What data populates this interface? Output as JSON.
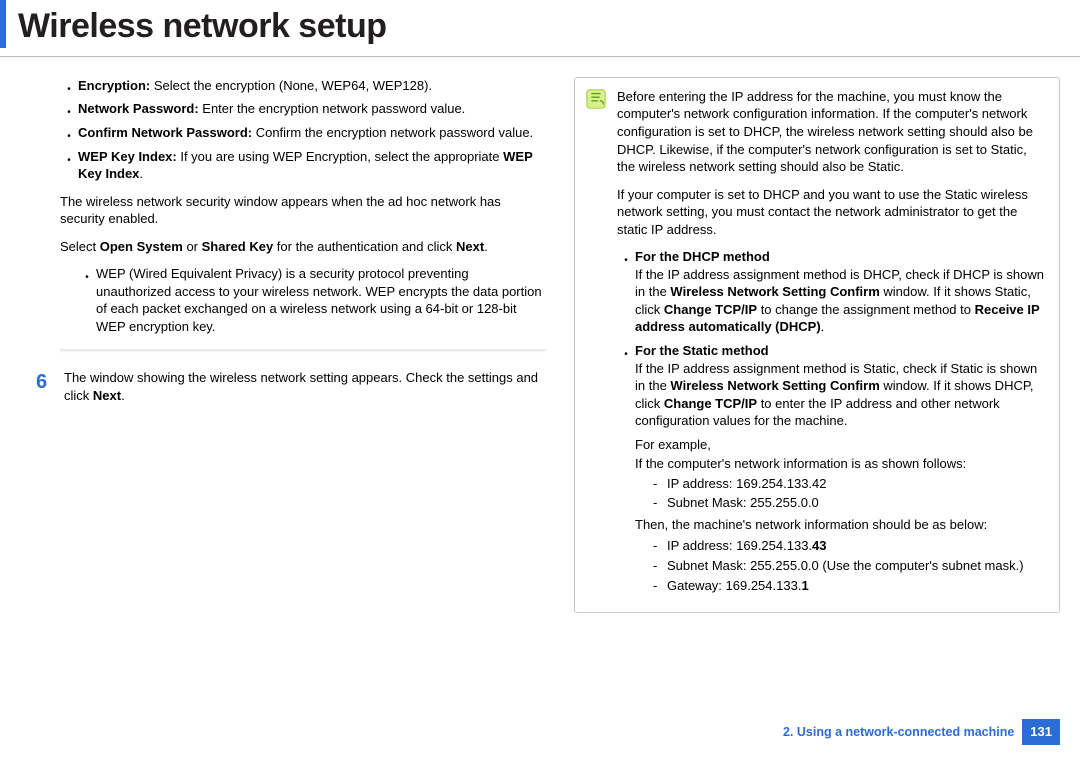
{
  "title": "Wireless network setup",
  "left": {
    "bullets": [
      {
        "label": "Encryption:",
        "text": " Select the encryption (None, WEP64, WEP128)."
      },
      {
        "label": "Network Password:",
        "text": " Enter the encryption network password value."
      },
      {
        "label": "Confirm Network Password:",
        "text": " Confirm the encryption network password value."
      },
      {
        "label": "WEP Key Index:",
        "text": " If you are using WEP Encryption, select the appropriate ",
        "tail_bold": "WEP Key Index",
        "tail_after": "."
      }
    ],
    "para1": "The wireless network security window appears when the ad hoc network has security enabled.",
    "para2_pre": "Select ",
    "para2_b1": "Open System",
    "para2_mid": " or ",
    "para2_b2": "Shared Key",
    "para2_post": " for the authentication and click ",
    "para2_b3": "Next",
    "para2_end": ".",
    "wep_note": "WEP (Wired Equivalent Privacy) is a security protocol preventing unauthorized access to your wireless network. WEP encrypts the data portion of each packet exchanged on a wireless network using a 64-bit or 128-bit WEP encryption key.",
    "step_num": "6",
    "step_text_pre": "The window showing the wireless network setting appears. Check the settings and click ",
    "step_text_b": "Next",
    "step_text_end": "."
  },
  "right": {
    "note1": "Before entering the IP address for the machine, you must know the computer's network configuration information. If the computer's network configuration is set to DHCP, the wireless network setting should also be DHCP. Likewise, if the computer's network configuration is set to Static, the wireless network setting should also be Static.",
    "note2": "If your computer is set to DHCP and you want to use the Static wireless network setting, you must contact the network administrator to get the static IP address.",
    "dhcp_heading": "For the DHCP method",
    "dhcp_pre": "If the IP address assignment method is DHCP, check if DHCP is shown in the ",
    "dhcp_b1": "Wireless Network Setting Confirm",
    "dhcp_mid1": " window. If it shows Static, click ",
    "dhcp_b2": "Change TCP/IP",
    "dhcp_mid2": " to change the assignment method to ",
    "dhcp_b3": "Receive IP address automatically (DHCP)",
    "dhcp_end": ".",
    "static_heading": "For the Static method",
    "static_pre": "If the IP address assignment method is Static, check if Static is shown in the ",
    "static_b1": "Wireless Network Setting Confirm",
    "static_mid1": " window. If it shows DHCP, click ",
    "static_b2": "Change TCP/IP",
    "static_mid2": " to enter the IP address and other network configuration values for the machine.",
    "for_example": "For example,",
    "follows": "If the computer's network information is as shown follows:",
    "ip1_label": "IP address: ",
    "ip1_val": "169.254.133.42",
    "mask1_label": "Subnet Mask: ",
    "mask1_val": "255.255.0.0",
    "then": "Then, the machine's network information should be as below:",
    "ip2_label": "IP address: 169.254.133.",
    "ip2_bold": "43",
    "mask2_label": "Subnet Mask: 255.255.0.0 (Use the computer's subnet mask.)",
    "gw_label": "Gateway: 169.254.133.",
    "gw_bold": "1"
  },
  "footer": {
    "chapter": "2.  Using a network-connected machine",
    "page": "131"
  }
}
